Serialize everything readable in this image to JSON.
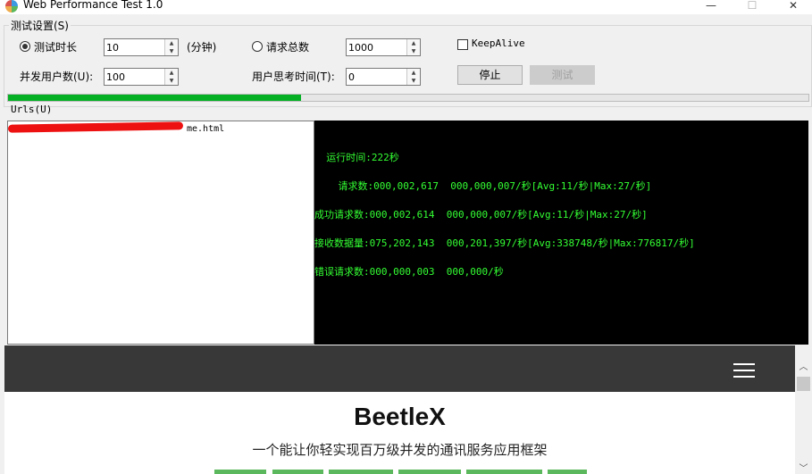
{
  "window": {
    "title": "Web Performance Test 1.0",
    "minimize": "—",
    "maximize": "☐",
    "close": "✕"
  },
  "settings": {
    "group_label": "测试设置(S)",
    "test_duration_label": "测试时长",
    "test_duration_value": "10",
    "duration_unit": "(分钟)",
    "total_requests_label": "请求总数",
    "total_requests_value": "1000",
    "keepalive_label": "KeepAlive",
    "concurrent_users_label": "并发用户数(U):",
    "concurrent_users_value": "100",
    "think_time_label": "用户思考时间(T):",
    "think_time_value": "0",
    "stop_button": "停止",
    "test_button": "测试"
  },
  "progress": {
    "fraction": 0.366
  },
  "urls": {
    "label": "Urls(U)",
    "entry_visible": "me.html"
  },
  "stats": {
    "runtime": "  运行时间:222秒",
    "requests": "    请求数:000,002,617  000,000,007/秒[Avg:11/秒|Max:27/秒]",
    "success": "成功请求数:000,002,614  000,000,007/秒[Avg:11/秒|Max:27/秒]",
    "received": "接收数据量:075,202,143  000,201,397/秒[Avg:338748/秒|Max:776817/秒]",
    "errors": "错误请求数:000,000,003  000,000/秒"
  },
  "preview": {
    "brand": "BeetleX",
    "tagline": "一个能让你轻实现百万级并发的通讯服务应用框架",
    "menu_icon": "hamburger-menu-icon"
  },
  "colors": {
    "progress": "#06b025",
    "stats_text": "#33ff33",
    "stats_bg": "#000000",
    "nav_bg": "#383838",
    "accent_green": "#5cb85c"
  }
}
